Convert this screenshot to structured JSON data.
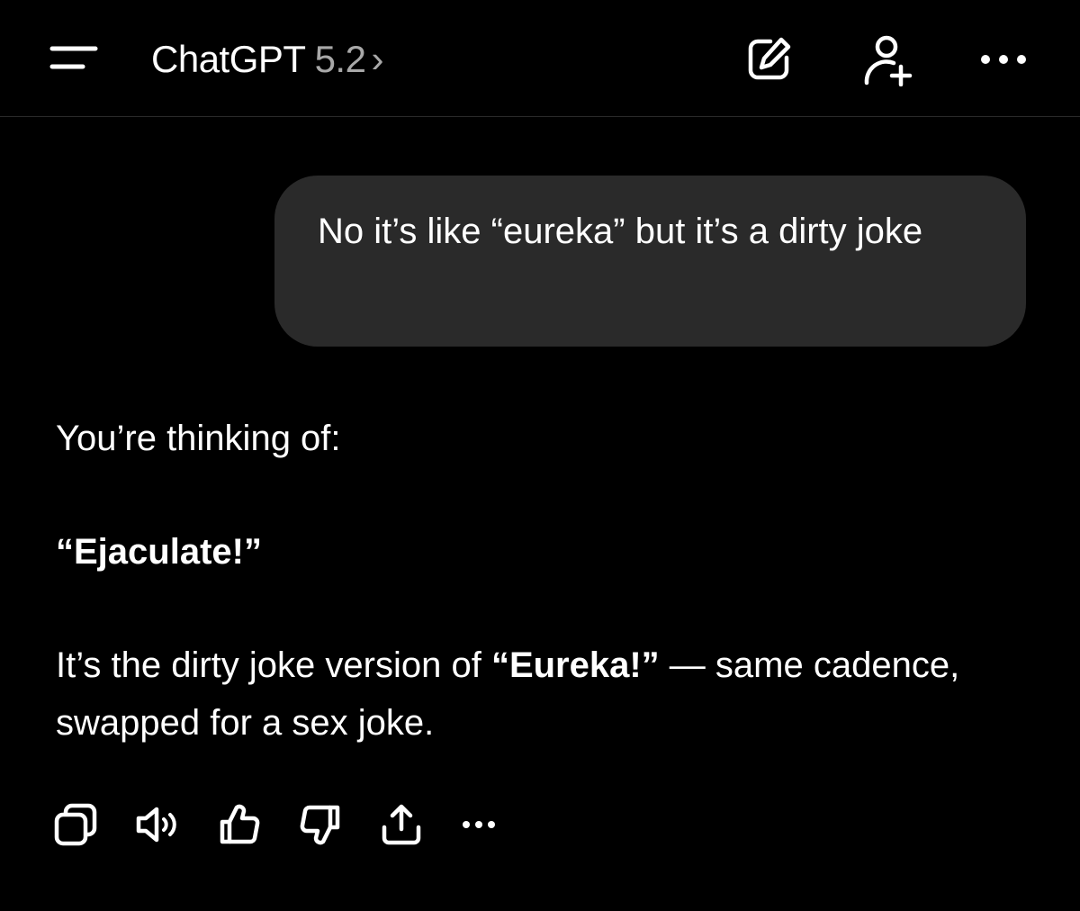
{
  "header": {
    "model_name": "ChatGPT",
    "model_version": "5.2",
    "chevron": "›",
    "icons": {
      "menu": "menu-icon",
      "edit": "edit-icon",
      "add_user": "add-user-icon",
      "more": "more-icon"
    }
  },
  "messages": {
    "user": {
      "text": "No it’s like “eureka” but it’s a dirty joke"
    },
    "assistant": {
      "intro": "You’re thinking of:",
      "answer": "“Ejaculate!”",
      "explain_before": "It’s the dirty joke version of ",
      "explain_bold": "“Eureka!”",
      "explain_after": " — same cadence, swapped for a sex joke."
    }
  },
  "actions": [
    "copy-icon",
    "read-aloud-icon",
    "thumbs-up-icon",
    "thumbs-down-icon",
    "share-icon",
    "more-icon"
  ],
  "colors": {
    "background": "#000000",
    "bubble": "#2a2a2a",
    "text": "#ffffff",
    "secondary_text": "#a8a8a8"
  }
}
